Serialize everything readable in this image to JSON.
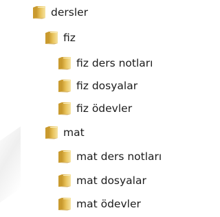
{
  "tree": {
    "root": {
      "label": "dersler",
      "icon": "folder-icon"
    },
    "children": [
      {
        "label": "fiz",
        "icon": "folder-icon",
        "children": [
          {
            "label": "fiz ders notları",
            "icon": "folder-icon"
          },
          {
            "label": "fiz dosyalar",
            "icon": "folder-icon"
          },
          {
            "label": "fiz ödevler",
            "icon": "folder-icon"
          }
        ]
      },
      {
        "label": "mat",
        "icon": "folder-icon",
        "children": [
          {
            "label": "mat ders notları",
            "icon": "folder-icon"
          },
          {
            "label": "mat dosyalar",
            "icon": "folder-icon"
          },
          {
            "label": "mat ödevler",
            "icon": "folder-icon"
          }
        ]
      }
    ]
  },
  "colors": {
    "folder_light": "#f6e3a1",
    "folder_main": "#e8c25b",
    "folder_dark": "#c99a2e",
    "text": "#1b1b1b"
  }
}
